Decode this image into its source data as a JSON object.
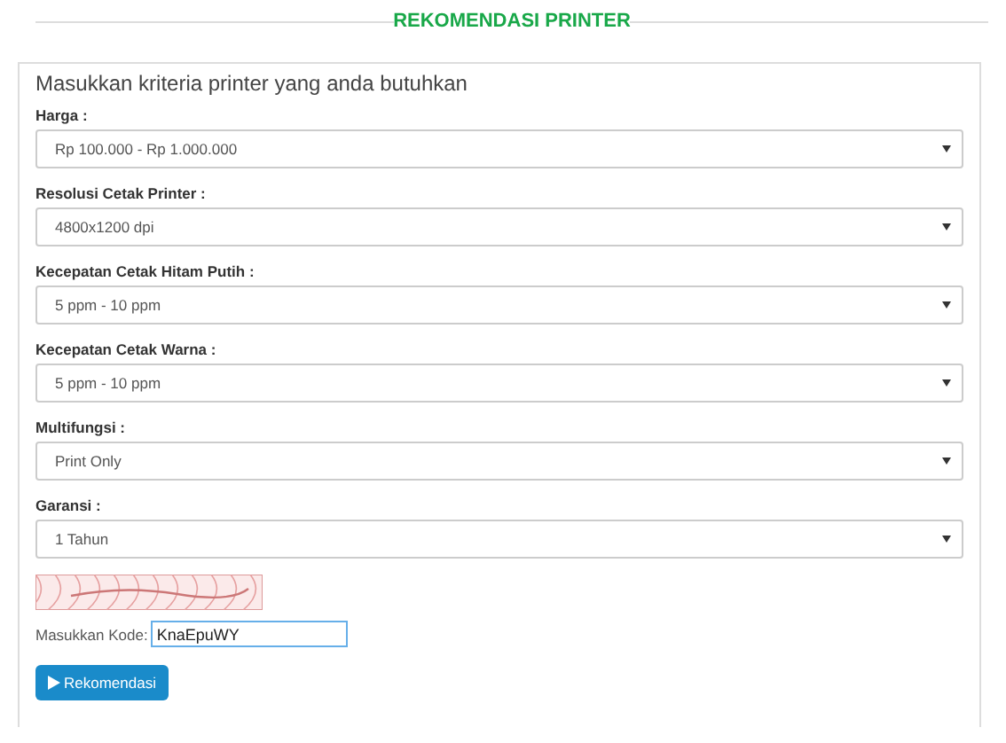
{
  "heading": "REKOMENDASI PRINTER",
  "form": {
    "title": "Masukkan kriteria printer yang anda butuhkan",
    "fields": [
      {
        "label": "Harga :",
        "value": "Rp 100.000 - Rp 1.000.000"
      },
      {
        "label": "Resolusi Cetak Printer :",
        "value": "4800x1200 dpi"
      },
      {
        "label": "Kecepatan Cetak Hitam Putih :",
        "value": "5 ppm - 10 ppm"
      },
      {
        "label": "Kecepatan Cetak Warna :",
        "value": "5 ppm - 10 ppm"
      },
      {
        "label": "Multifungsi :",
        "value": "Print Only"
      },
      {
        "label": "Garansi :",
        "value": "1 Tahun"
      }
    ],
    "code": {
      "label": "Masukkan Kode:",
      "value": "KnaEpuWY"
    },
    "submit": "Rekomendasi"
  }
}
